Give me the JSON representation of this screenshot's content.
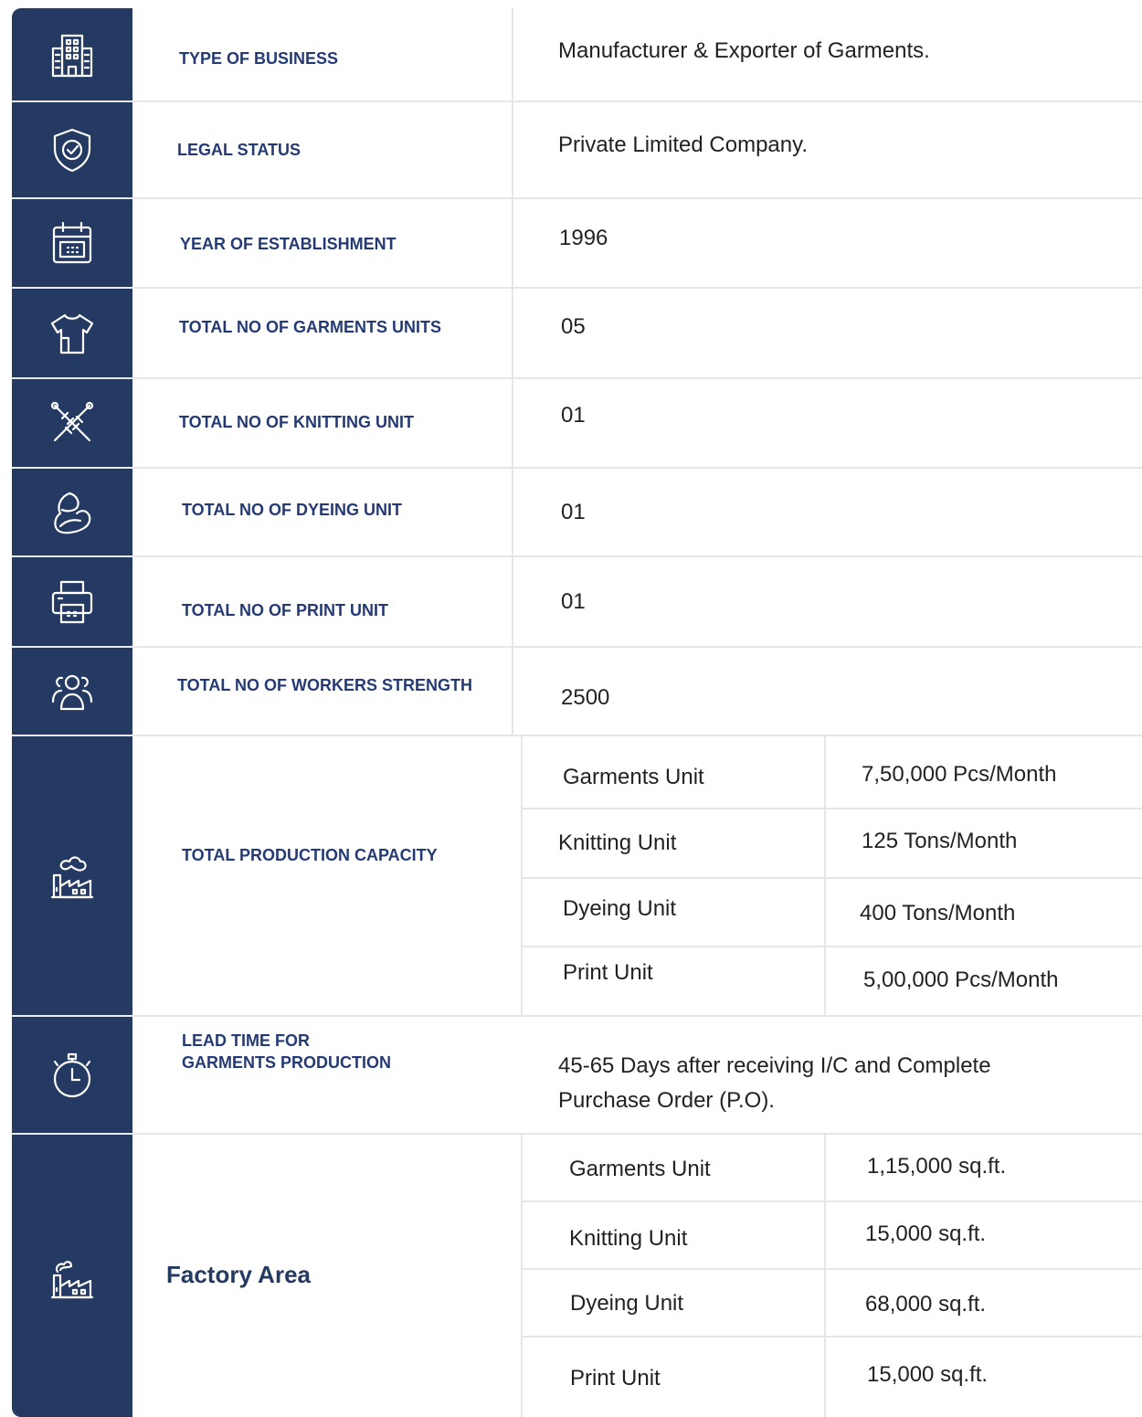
{
  "theme": {
    "sidebar_color": "#243a63",
    "label_color": "#243a75",
    "text_color": "#222222"
  },
  "rows": [
    {
      "icon": "building-icon",
      "label": "TYPE OF BUSINESS",
      "value": "Manufacturer & Exporter of Garments."
    },
    {
      "icon": "shield-check-icon",
      "label": "LEGAL STATUS",
      "value": "Private Limited Company."
    },
    {
      "icon": "calendar-icon",
      "label": "YEAR OF ESTABLISHMENT",
      "value": "1996"
    },
    {
      "icon": "tshirt-icon",
      "label": "TOTAL NO OF GARMENTS UNITS",
      "value": "05"
    },
    {
      "icon": "knitting-needles-icon",
      "label": "TOTAL NO OF KNITTING UNIT",
      "value": "01"
    },
    {
      "icon": "dye-drop-icon",
      "label": "TOTAL NO OF DYEING UNIT",
      "value": "01"
    },
    {
      "icon": "printer-icon",
      "label": "TOTAL NO OF PRINT UNIT",
      "value": "01"
    },
    {
      "icon": "workers-group-icon",
      "label": "TOTAL NO OF WORKERS STRENGTH",
      "value": "2500"
    }
  ],
  "production_capacity": {
    "icon": "factory-icon",
    "label": "TOTAL PRODUCTION CAPACITY",
    "items": [
      {
        "unit": "Garments Unit",
        "value": "7,50,000 Pcs/Month"
      },
      {
        "unit": "Knitting Unit",
        "value": "125 Tons/Month"
      },
      {
        "unit": "Dyeing Unit",
        "value": "400 Tons/Month"
      },
      {
        "unit": "Print Unit",
        "value": "5,00,000 Pcs/Month"
      }
    ]
  },
  "lead_time": {
    "icon": "stopwatch-icon",
    "label_line1": "LEAD TIME FOR",
    "label_line2": "GARMENTS PRODUCTION",
    "value_line1": "45-65 Days after receiving I/C and Complete",
    "value_line2": "Purchase Order (P.O)."
  },
  "factory_area": {
    "icon": "factory-icon",
    "label": "Factory Area",
    "items": [
      {
        "unit": "Garments Unit",
        "value": "1,15,000 sq.ft."
      },
      {
        "unit": "Knitting Unit",
        "value": "15,000 sq.ft."
      },
      {
        "unit": "Dyeing Unit",
        "value": "68,000 sq.ft."
      },
      {
        "unit": "Print Unit",
        "value": "15,000 sq.ft."
      }
    ]
  }
}
